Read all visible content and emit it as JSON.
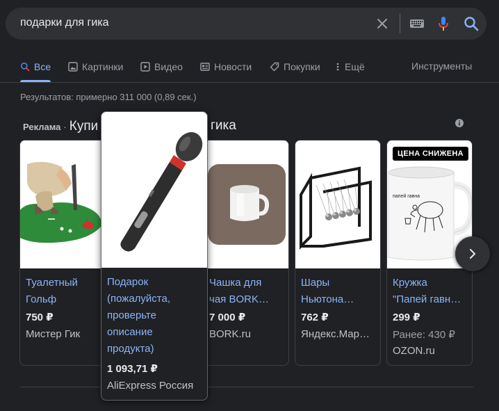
{
  "search": {
    "query": "подарки для гика"
  },
  "tabs": [
    {
      "label": "Все",
      "icon": "search-icon",
      "active": true
    },
    {
      "label": "Картинки",
      "icon": "image-icon"
    },
    {
      "label": "Видео",
      "icon": "video-icon"
    },
    {
      "label": "Новости",
      "icon": "news-icon"
    },
    {
      "label": "Покупки",
      "icon": "tag-icon"
    },
    {
      "label": "Ещё",
      "icon": "more-vert-icon"
    }
  ],
  "tools_label": "Инструменты",
  "results_stats": "Результатов: примерно 311 000 (0,89 сек.)",
  "ads": {
    "label": "Реклама",
    "separator": "·",
    "title_start": "Купи",
    "title_end": "гика"
  },
  "products": [
    {
      "title_line1": "Туалетный",
      "title_line2": "Гольф",
      "price": "750 ₽",
      "merchant": "Мистер Гик"
    },
    {
      "title_lines": [
        "Подарок",
        "(пожалуйста,",
        "проверьте",
        "описание",
        "продукта)"
      ],
      "price": "1 093,71 ₽",
      "merchant": "AliExpress Россия"
    },
    {
      "title_line1": "Чашка для",
      "title_line2": "чая BORK…",
      "price": "7 000 ₽",
      "merchant": "BORK.ru"
    },
    {
      "title_line1": "Шары",
      "title_line2": "Ньютона…",
      "price": "762 ₽",
      "merchant": "Яндекс.Мар…"
    },
    {
      "badge": "ЦЕНА СНИЖЕНА",
      "mug_text": "папей гавна",
      "title_line1": "Кружка",
      "title_line2": "\"Папей гавн…",
      "price": "299 ₽",
      "was_price": "Ранее: 430 ₽",
      "merchant": "OZON.ru"
    }
  ],
  "colors": {
    "background": "#202124",
    "link": "#8ab4f8",
    "surface": "#303134",
    "mic_red": "#ea4335",
    "golf_green": "#2e8b3a"
  }
}
